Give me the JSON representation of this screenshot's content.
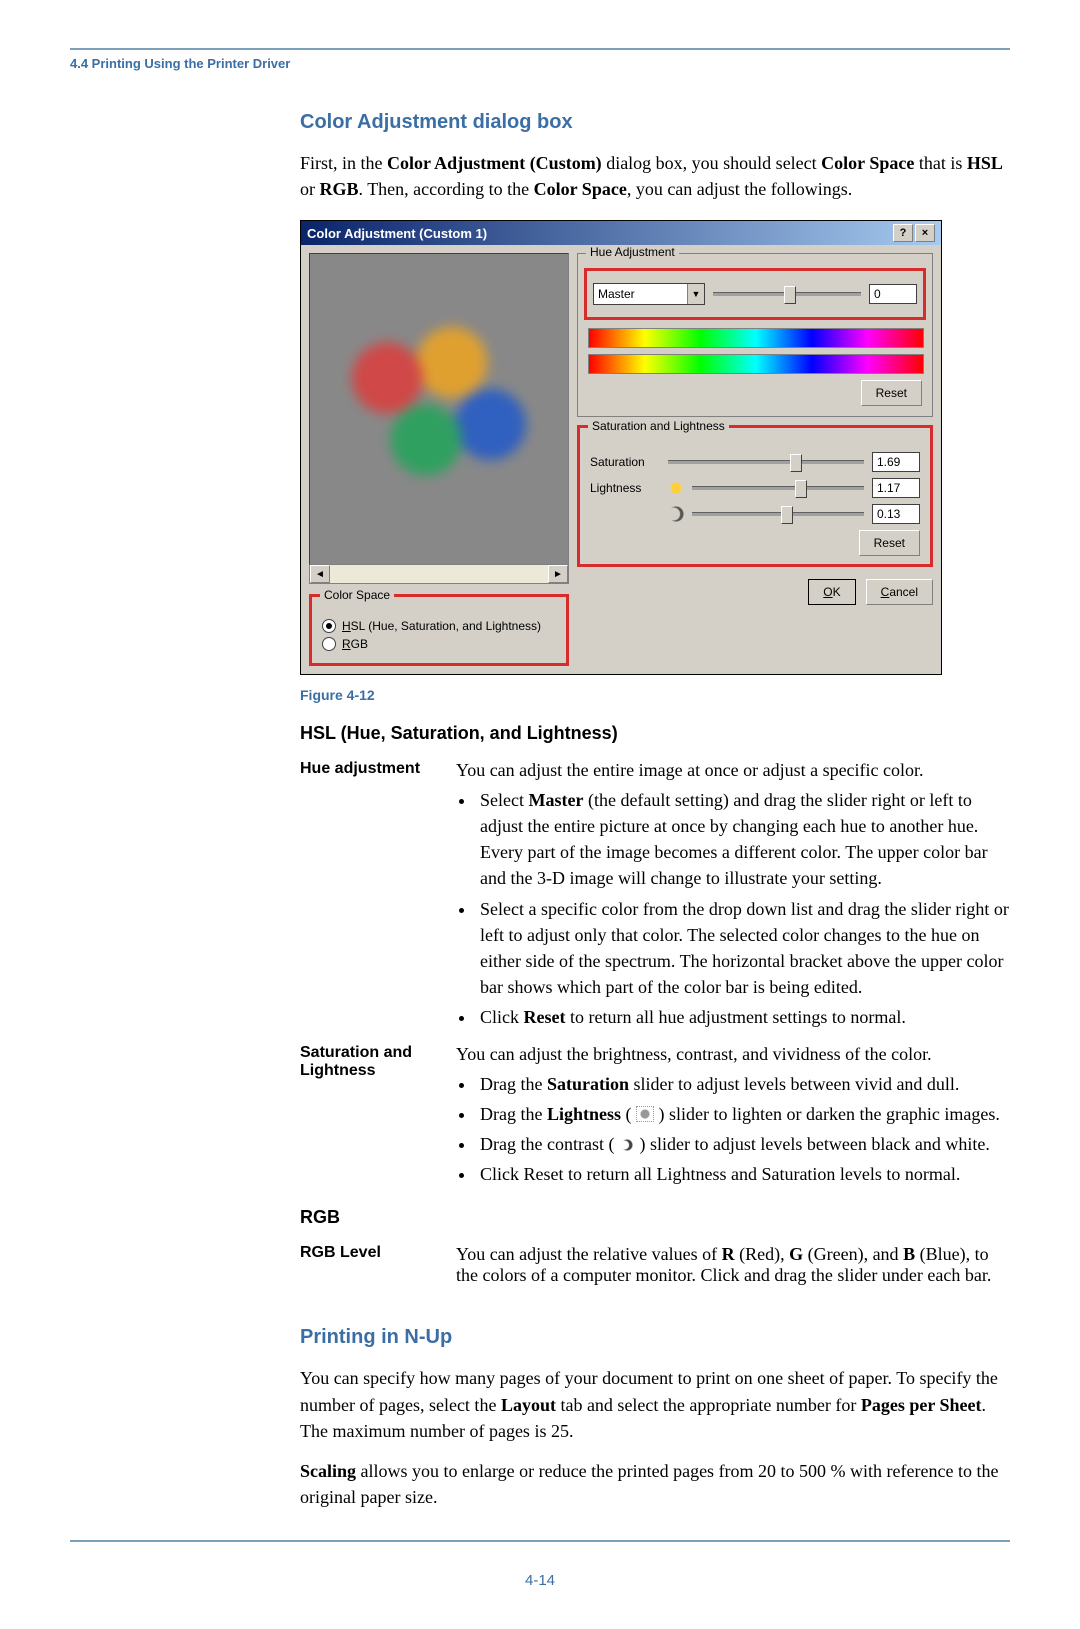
{
  "header": {
    "breadcrumb": "4.4 Printing Using the Printer Driver"
  },
  "s1": {
    "title": "Color Adjustment dialog box",
    "p1": {
      "a": "First, in the",
      "b": "Color Adjustment (Custom)",
      "c": "dialog box, you should select",
      "d": "Color Space",
      "e": "that is",
      "f": "HSL",
      "g": "or",
      "h": "RGB",
      "i": ". Then, according to the",
      "j": "Color Space",
      "k": ", you can adjust the followings."
    },
    "figcap": "Figure 4-12"
  },
  "dlg": {
    "title": "Color Adjustment (Custom 1)",
    "cs": {
      "legend": "Color Space",
      "hsl_u": "H",
      "hsl_rest": "SL (Hue, Saturation, and Lightness)",
      "rgb_u": "R",
      "rgb_rest": "GB"
    },
    "hue": {
      "legend": "Hue Adjustment",
      "select": "Master",
      "value": "0"
    },
    "sat": {
      "legend": "Saturation and Lightness",
      "sat_label": "Saturation",
      "sat_val": "1.69",
      "light_label": "Lightness",
      "light_val": "1.17",
      "con_val": "0.13"
    },
    "reset": "Reset",
    "ok_u": "O",
    "ok_rest": "K",
    "cancel_u": "C",
    "cancel_rest": "ancel"
  },
  "hsl": {
    "title": "HSL (Hue, Saturation, and Lightness)",
    "r1": {
      "term": "Hue adjustment",
      "desc": "You can adjust the entire image at once or adjust a specific color.",
      "b1a": "Select",
      "b1b": "Master",
      "b1c": "(the default setting) and drag the slider right or left to adjust the entire picture at once by changing each hue to another hue. Every part of the image becomes a different color. The upper color bar and the 3-D image will change to illustrate your setting.",
      "b2": "Select a specific color from the drop down list and drag the slider right or left to adjust only that color. The selected color changes to the hue on either side of the spectrum. The horizontal bracket above the upper color bar shows which part of the color bar is being edited.",
      "b3a": "Click",
      "b3b": "Reset",
      "b3c": "to return all hue adjustment settings to normal."
    },
    "r2": {
      "term": "Saturation and Lightness",
      "desc": "You can adjust the brightness, contrast, and vividness of the color.",
      "b1a": "Drag the",
      "b1b": "Saturation",
      "b1c": "slider to adjust levels between vivid and dull.",
      "b2a": "Drag the",
      "b2b": "Lightness",
      "b2c": "(",
      "b2d": ") slider to lighten or darken the graphic images.",
      "b3a": "Drag the contrast (",
      "b3b": ") slider to adjust levels between black and white.",
      "b4": "Click Reset to return all Lightness and Saturation levels to normal."
    }
  },
  "rgb": {
    "title": "RGB",
    "r1": {
      "term": "RGB Level",
      "a": "You can adjust the relative values of",
      "b": "R",
      "c": "(Red),",
      "d": "G",
      "e": "(Green), and",
      "f": "B",
      "g": "(Blue), to the colors of a computer monitor. Click and drag the slider under each bar."
    }
  },
  "nup": {
    "title": "Printing in N-Up",
    "p1a": "You can specify how many pages of your document to print on one sheet of paper. To specify the number of pages, select the",
    "p1b": "Layout",
    "p1c": "tab and select the appropriate number for",
    "p1d": "Pages per Sheet",
    "p1e": ". The maximum number of pages is 25.",
    "p2a": "Scaling",
    "p2b": "allows you to enlarge or reduce the printed pages from 20 to 500 % with reference to the original paper size."
  },
  "footer": {
    "page": "4-14"
  }
}
